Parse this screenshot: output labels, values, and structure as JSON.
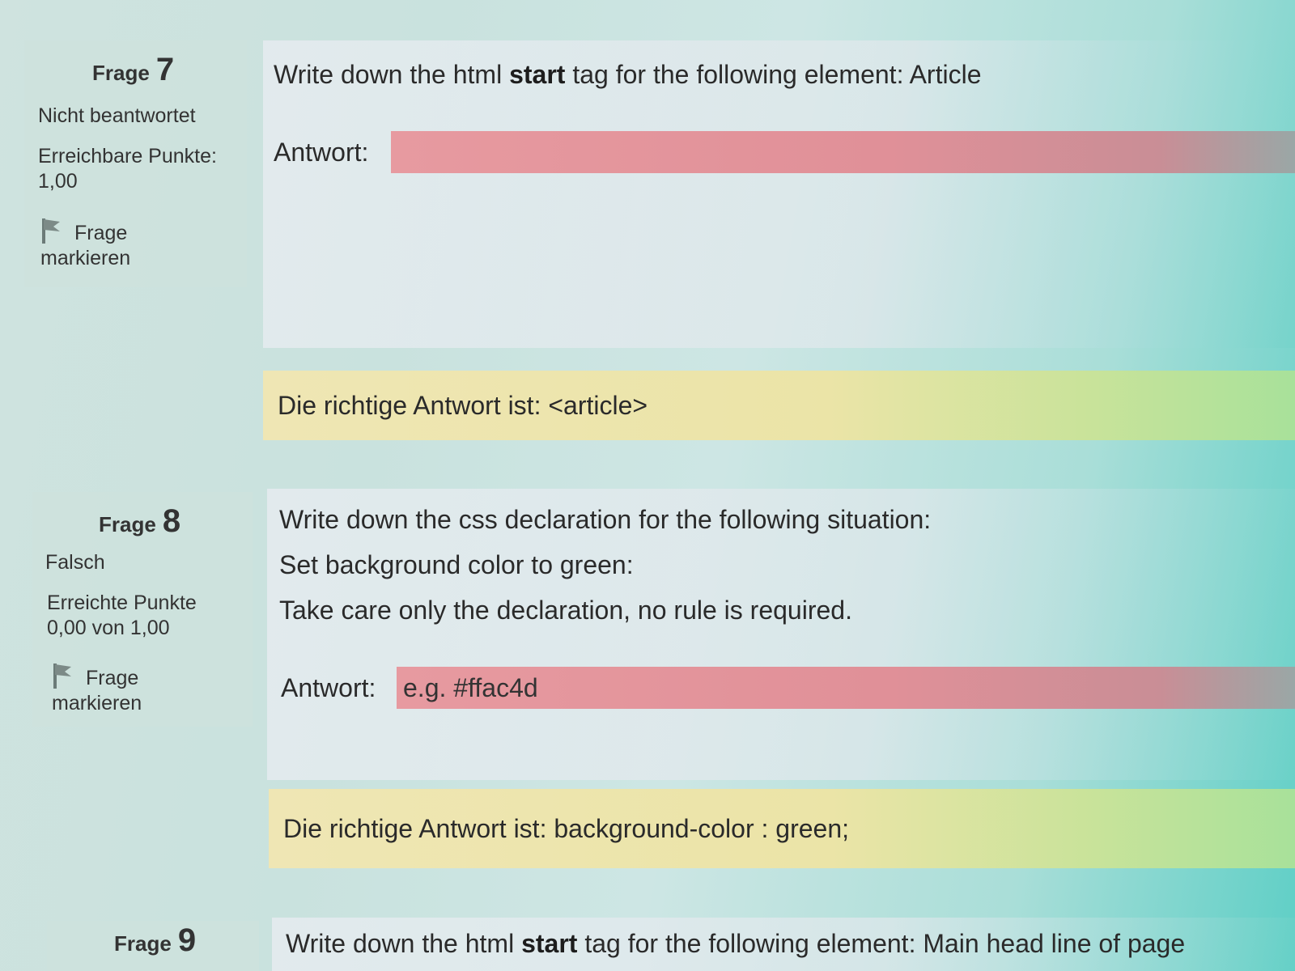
{
  "questions": [
    {
      "label": "Frage",
      "number": "7",
      "status": "Nicht beantwortet",
      "points_label": "Erreichbare Punkte:",
      "points_value": "1,00",
      "flag_line1": "Frage",
      "flag_line2": "markieren",
      "prompt_before": "Write down the html ",
      "prompt_bold": "start",
      "prompt_after": " tag for the following element: Article",
      "answer_label": "Antwort:",
      "answer_value": "",
      "answer_placeholder": "",
      "correct_answer": "Die richtige Antwort ist: <article>"
    },
    {
      "label": "Frage",
      "number": "8",
      "status": "Falsch",
      "points_label": "Erreichte Punkte",
      "points_value": "0,00 von 1,00",
      "flag_line1": "Frage",
      "flag_line2": "markieren",
      "prompt_line1": "Write down the css declaration for the following situation:",
      "prompt_line2": "Set background color to green:",
      "prompt_line3": "Take care only the declaration, no rule is required.",
      "answer_label": "Antwort:",
      "answer_value": "e.g. #ffac4d",
      "correct_answer": "Die richtige Antwort ist: background-color : green;"
    },
    {
      "label": "Frage",
      "number": "9",
      "prompt_before": "Write down the html ",
      "prompt_bold": "start",
      "prompt_after": " tag for the following element: Main head line of page"
    }
  ],
  "icons": {
    "flag": "flag-icon"
  },
  "colors": {
    "answer_field": "#e79aa0",
    "correct_box": "#efe6b4",
    "info_panel": "#cde1dc"
  }
}
